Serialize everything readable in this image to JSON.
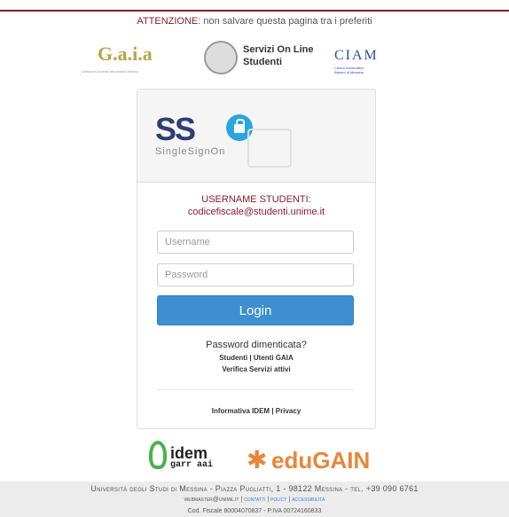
{
  "warning": {
    "prefix": "ATTENZIONE",
    "text": ": non salvare questa pagina tra i preferiti"
  },
  "logos": {
    "gaia": {
      "name": "G.a.i.a",
      "tagline": "Gestione Accessi Informatici Ateneo"
    },
    "servizi": {
      "line1": "Servizi On Line",
      "line2": "Studenti"
    },
    "ciam": {
      "name": "CIAM",
      "sub1": "Centro Informatico",
      "sub2": "Ateneo di Messina"
    }
  },
  "sso": {
    "title": "SS",
    "subtitle": "SingleSignOn"
  },
  "login": {
    "info_line1": "USERNAME STUDENTI:",
    "info_line2": "codicefiscale@studenti.unime.it",
    "username_placeholder": "Username",
    "password_placeholder": "Password",
    "button": "Login",
    "forgot": "Password dimenticata?",
    "link_studenti": "Studenti",
    "link_utenti_gaia": "Utenti GAIA",
    "link_verifica": "Verifica Servizi attivi",
    "link_informativa": "Informativa IDEM",
    "link_privacy": "Privacy",
    "separator": "|"
  },
  "partners": {
    "idem_top": "idem",
    "idem_bottom": "garr aai",
    "edugain": "eduGAIN"
  },
  "footer": {
    "address": "Università degli Studi di Messina - Piazza Pugliatti, 1 - 98122 Messina - tel. +39 090 6761",
    "webmaster": "webmaster@unime.it",
    "contatti": "contatti",
    "policy": "policy",
    "accessibilita": "accessibilità",
    "fiscal": "Cod. Fiscale 80004070837 - P.IVA 00724160833"
  },
  "colors": {
    "brand": "#8a1c2b",
    "button": "#3d8fd1",
    "edugain": "#e8863a"
  }
}
